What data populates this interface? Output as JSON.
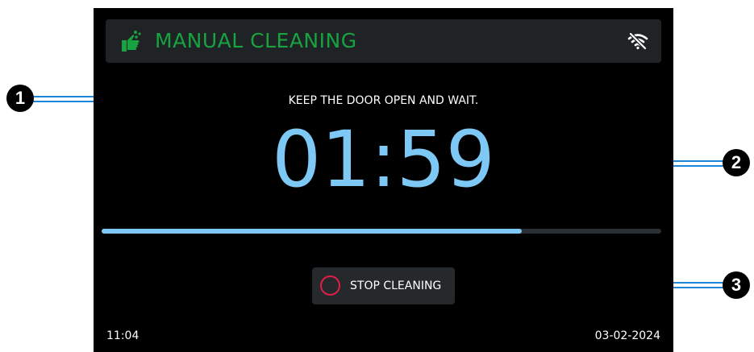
{
  "header": {
    "title": "MANUAL CLEANING",
    "icon": "cleaning-hand-icon",
    "status_icon": "wifi-off-icon",
    "title_color": "#18a340"
  },
  "main": {
    "instruction": "KEEP THE DOOR OPEN AND WAIT.",
    "timer": "01:59",
    "timer_color": "#7ec8f5",
    "progress_fraction": 0.75
  },
  "actions": {
    "stop_label": "STOP CLEANING",
    "stop_icon": "stop-circle-icon",
    "stop_color": "#e11d48"
  },
  "footer": {
    "time": "11:04",
    "date": "03-02-2024"
  },
  "callouts": {
    "one": "1",
    "two": "2",
    "three": "3",
    "color": "#1e86d8"
  }
}
